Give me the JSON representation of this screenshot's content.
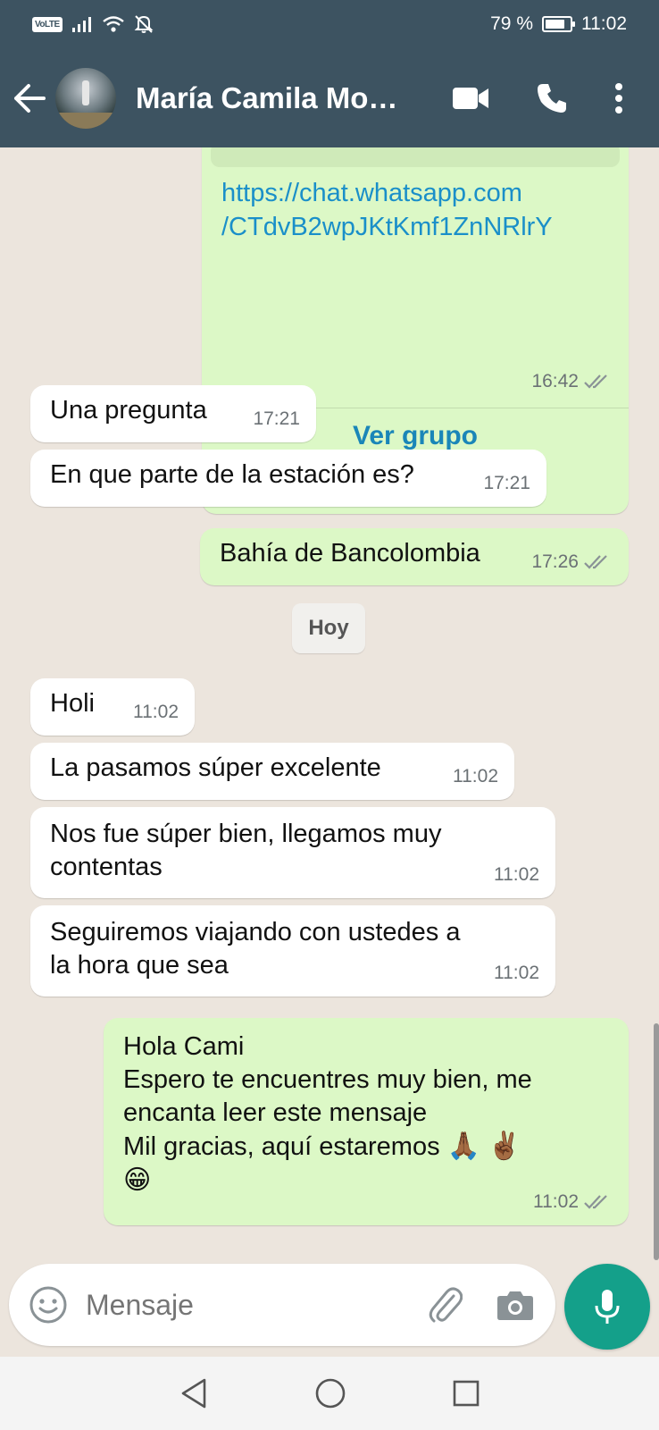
{
  "status_bar": {
    "volte": "VoLTE",
    "battery_text": "79 %",
    "battery_level": 0.79,
    "time": "11:02"
  },
  "header": {
    "contact_name": "María Camila Mo…"
  },
  "link_card": {
    "url_line1": "https://chat.whatsapp.com",
    "url_line2": "/CTdvB2wpJKtKmf1ZnNRlrY",
    "time": "16:42",
    "action": "Ver grupo"
  },
  "messages": [
    {
      "text": "Una pregunta",
      "time": "17:21"
    },
    {
      "text": "En que parte de la estación es?",
      "time": "17:21"
    },
    {
      "text": "Bahía de Bancolombia",
      "time": "17:26"
    }
  ],
  "date_chip": "Hoy",
  "today_messages": [
    {
      "text": "Holi",
      "time": "11:02"
    },
    {
      "text": "La pasamos súper excelente",
      "time": "11:02"
    },
    {
      "line1": "Nos fue súper bien, llegamos muy",
      "line2": "contentas",
      "time": "11:02"
    },
    {
      "line1": "Seguiremos viajando con ustedes a",
      "line2": "la hora que sea",
      "time": "11:02"
    }
  ],
  "reply": {
    "line1": "Hola Cami",
    "line2": "Espero te encuentres muy bien, me",
    "line3": "encanta leer este mensaje",
    "line4": "Mil gracias, aquí estaremos",
    "emoji_hands": "🙏🏾",
    "emoji_victory": "✌🏾",
    "emoji_smile": "😁",
    "time": "11:02"
  },
  "input": {
    "placeholder": "Mensaje"
  },
  "colors": {
    "header": "#3d5361",
    "outgoing": "#dcf8c6",
    "incoming": "#ffffff",
    "accent": "#14a08a",
    "link": "#1a8fc9"
  },
  "icons": [
    "back-arrow-icon",
    "video-call-icon",
    "phone-icon",
    "more-options-icon",
    "emoji-icon",
    "attach-icon",
    "camera-icon",
    "mic-icon",
    "nav-back-icon",
    "nav-home-icon",
    "nav-recents-icon",
    "double-check-icon"
  ]
}
